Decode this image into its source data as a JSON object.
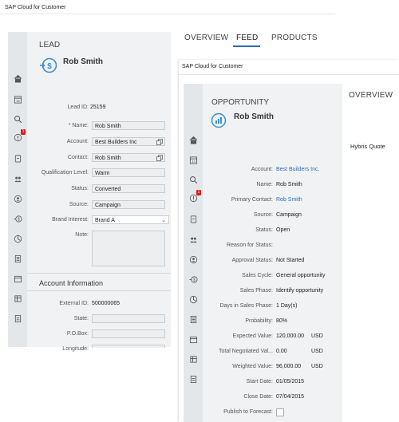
{
  "lead_window": {
    "app_title": "SAP Cloud for Customer",
    "object_type": "LEAD",
    "name": "Rob Smith",
    "tabs": [
      "OVERVIEW",
      "FEED",
      "PRODUCTS"
    ],
    "active_tab": "FEED",
    "fields": [
      {
        "label": "Lead ID:",
        "value": "25159",
        "kind": "text"
      },
      {
        "label": "Name:",
        "value": "Rob Smith",
        "kind": "input",
        "required": true
      },
      {
        "label": "Account:",
        "value": "Best Builders Inc",
        "kind": "input-lookup"
      },
      {
        "label": "Contact:",
        "value": "Rob Smith",
        "kind": "input-lookup"
      },
      {
        "label": "Qualification Level:",
        "value": "Warm",
        "kind": "input"
      },
      {
        "label": "Status:",
        "value": "Converted",
        "kind": "input"
      },
      {
        "label": "Source:",
        "value": "Campaign",
        "kind": "input"
      },
      {
        "label": "Brand Interest:",
        "value": "Brand A",
        "kind": "select"
      },
      {
        "label": "Note:",
        "value": "",
        "kind": "textarea"
      }
    ],
    "section_title": "Account Information",
    "account_fields": [
      {
        "label": "External ID:",
        "value": "500000065",
        "kind": "text"
      },
      {
        "label": "State:",
        "value": "",
        "kind": "input"
      },
      {
        "label": "P.O.Box:",
        "value": "",
        "kind": "input"
      },
      {
        "label": "Longitude:",
        "value": "",
        "kind": "input"
      }
    ],
    "notification_count": "1"
  },
  "opportunity_window": {
    "app_title": "SAP Cloud for Customer",
    "object_type": "OPPORTUNITY",
    "name": "Rob Smith",
    "tabs": [
      "OVERVIEW"
    ],
    "right_item": "Hybris Quote",
    "fields": [
      {
        "label": "Account:",
        "value": "Best Builders Inc.",
        "link": true
      },
      {
        "label": "Name:",
        "value": "Rob Smith"
      },
      {
        "label": "Primary Contact:",
        "value": "Rob Smith",
        "link": true
      },
      {
        "label": "Source:",
        "value": "Campaign"
      },
      {
        "label": "Status:",
        "value": "Open"
      },
      {
        "label": "Reason for Status:",
        "value": ""
      },
      {
        "label": "Approval Status:",
        "value": "Not Started"
      },
      {
        "label": "Sales Cycle:",
        "value": "General opportunity"
      },
      {
        "label": "Sales Phase:",
        "value": "Identify opportunity"
      },
      {
        "label": "Days in Sales Phase:",
        "value": "1 Day(s)"
      },
      {
        "label": "Probability:",
        "value": "80%"
      },
      {
        "label": "Expected Value:",
        "value": "120,000.00",
        "unit": "USD"
      },
      {
        "label": "Total Negotiated Val...",
        "value": "0.00",
        "unit": "USD"
      },
      {
        "label": "Weighted Value:",
        "value": "96,000.00",
        "unit": "USD"
      },
      {
        "label": "Start Date:",
        "value": "01/05/2015"
      },
      {
        "label": "Close Date:",
        "value": "07/04/2015"
      },
      {
        "label": "Publish to Forecast:",
        "value": "",
        "checkbox": true
      }
    ],
    "notification_count": "1"
  },
  "colors": {
    "sidebar": "#e4e7ea",
    "form_panel": "#f1f2f3",
    "content_bg": "#ffffff",
    "active_tab_underline": "#2a6ebb",
    "link": "#2a6ebb",
    "badge": "#d81b1b"
  }
}
